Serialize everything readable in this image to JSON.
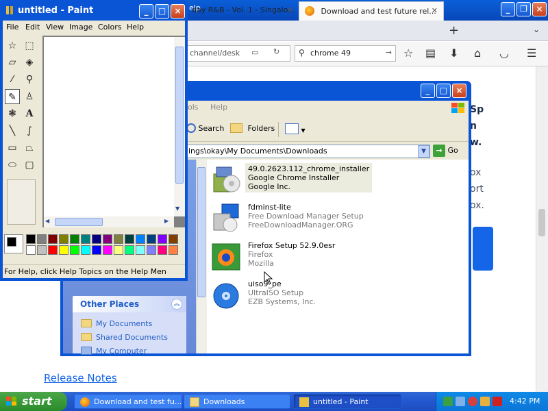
{
  "firefox": {
    "title_menu_help": "elp",
    "tabs": [
      {
        "label": "day R&B - Vol. 1 - Singalo..."
      },
      {
        "label": "Download and test future rel..."
      }
    ],
    "url_text": "channel/desk",
    "search_value": "chrome 49",
    "side_text": [
      "Sp",
      "n",
      "w.",
      "ox",
      "ort",
      "ox."
    ],
    "release_notes": "Release Notes"
  },
  "explorer": {
    "menu": [
      "ols",
      "Help"
    ],
    "toolbar": {
      "search": "Search",
      "folders": "Folders"
    },
    "address": "ings\\okay\\My Documents\\Downloads",
    "go_label": "Go",
    "other_places_title": "Other Places",
    "places": [
      "My Documents",
      "Shared Documents",
      "My Computer"
    ],
    "files": [
      {
        "name": "49.0.2623.112_chrome_installer",
        "desc": "Google Chrome Installer",
        "company": "Google Inc.",
        "icon": "chrome-installer-icon"
      },
      {
        "name": "fdminst-lite",
        "desc": "Free Download Manager Setup",
        "company": "FreeDownloadManager.ORG",
        "icon": "fdm-installer-icon"
      },
      {
        "name": "Firefox Setup 52.9.0esr",
        "desc": "Firefox",
        "company": "Mozilla",
        "icon": "firefox-installer-icon"
      },
      {
        "name": "uiso9_pe",
        "desc": "UltraISO Setup",
        "company": "EZB Systems, Inc.",
        "icon": "ultraiso-installer-icon"
      }
    ]
  },
  "paint": {
    "title": "untitled - Paint",
    "menu": [
      "File",
      "Edit",
      "View",
      "Image",
      "Colors",
      "Help"
    ],
    "status": "For Help, click Help Topics on the Help Men",
    "palette_top": [
      "#000000",
      "#808080",
      "#800000",
      "#808000",
      "#008000",
      "#008080",
      "#000080",
      "#800080",
      "#808040",
      "#004040",
      "#0080ff",
      "#004080",
      "#8000ff",
      "#804000"
    ],
    "palette_bottom": [
      "#ffffff",
      "#c0c0c0",
      "#ff0000",
      "#ffff00",
      "#00ff00",
      "#00ffff",
      "#0000ff",
      "#ff00ff",
      "#ffff80",
      "#00ff80",
      "#80ffff",
      "#8080ff",
      "#ff0080",
      "#ff8040"
    ]
  },
  "taskbar": {
    "start_label": "start",
    "tasks": [
      "Download and test fu...",
      "Downloads",
      "untitled - Paint"
    ],
    "clock": "4:42 PM"
  }
}
